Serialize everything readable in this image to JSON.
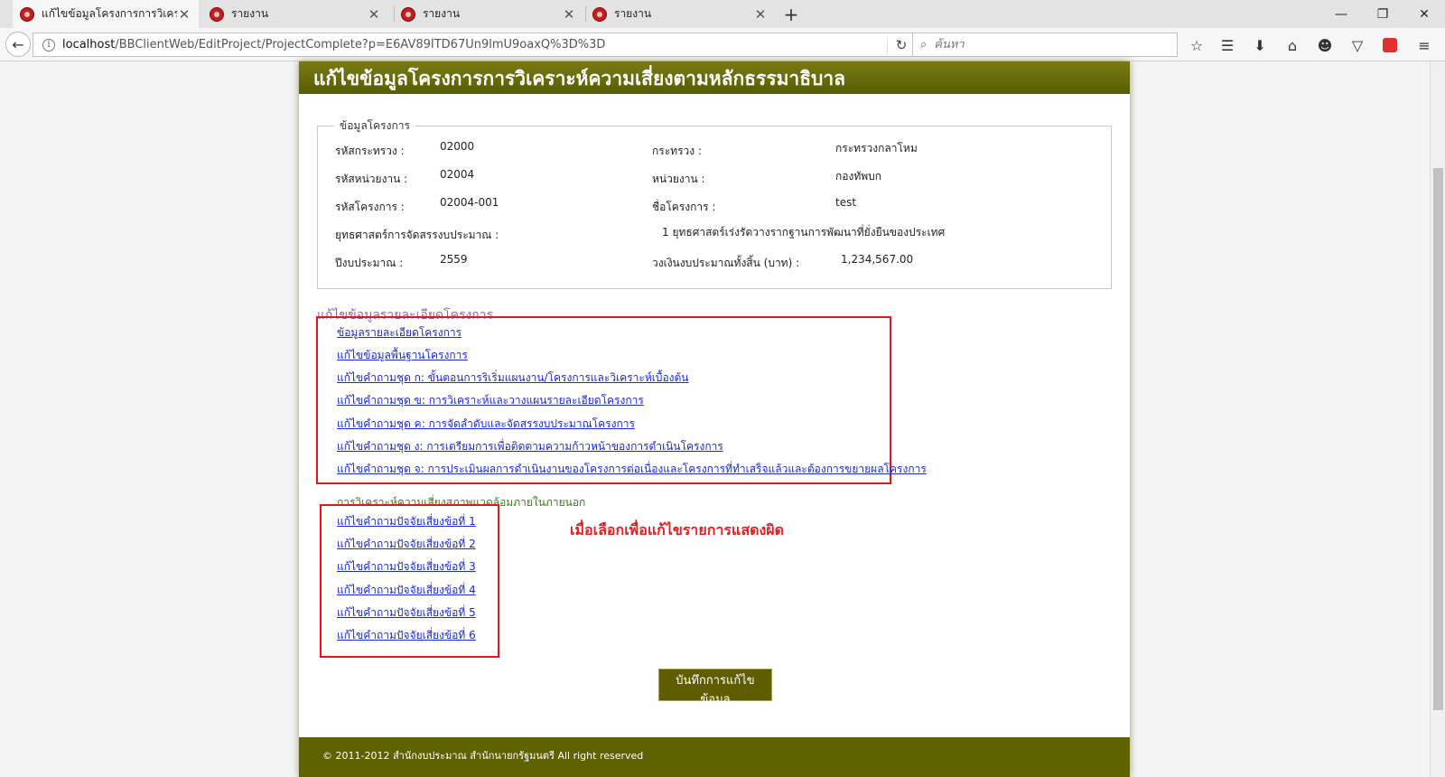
{
  "browser": {
    "tabs": [
      {
        "label": "แก้ไขข้อมูลโครงการการวิเคร...",
        "active": true,
        "close": "✕"
      },
      {
        "label": "รายงาน",
        "active": false,
        "close": "✕"
      },
      {
        "label": "รายงาน",
        "active": false,
        "close": "✕"
      },
      {
        "label": "รายงาน",
        "active": false,
        "close": "✕"
      }
    ],
    "new_tab": "+",
    "url_host": "localhost",
    "url_path": "/BBClientWeb/EditProject/ProjectComplete?p=E6AV89ITD67Un9lmU9oaxQ%3D%3D",
    "search_placeholder": "ค้นหา",
    "icons": [
      "star-icon",
      "reading-list-icon",
      "download-icon",
      "home-icon",
      "chat-icon",
      "pocket-icon",
      "extension-icon",
      "menu-icon"
    ]
  },
  "page": {
    "title": "แก้ไขข้อมูลโครงการการวิเคราะห์ความเสี่ยงตามหลักธรรมาธิบาล",
    "info_legend": "ข้อมูลโครงการ",
    "fields": {
      "ministry_code_label": "รหัสกระทรวง :",
      "ministry_code": "02000",
      "ministry_label": "กระทรวง :",
      "ministry": "กระทรวงกลาโหม",
      "dept_code_label": "รหัสหน่วยงาน :",
      "dept_code": "02004",
      "dept_label": "หน่วยงาน :",
      "dept": "กองทัพบก",
      "project_code_label": "รหัสโครงการ :",
      "project_code": "02004-001",
      "project_name_label": "ชื่อโครงการ :",
      "project_name": "test",
      "strategy_label": "ยุทธศาสตร์การจัดสรรงบประมาณ :",
      "strategy": "1 ยุทธศาสตร์เร่งรัดวางรากฐานการพัฒนาที่ยั่งยืนของประเทศ",
      "fiscal_year_label": "ปีงบประมาณ :",
      "fiscal_year": "2559",
      "budget_label": "วงเงินงบประมาณทั้งสิ้น (บาท) :",
      "budget": "1,234,567.00"
    },
    "detail_section_title": "แก้ไขข้อมูลรายละเอียดโครงการ",
    "detail_links": [
      "ข้อมูลรายละเอียดโครงการ",
      "แก้ไขข้อมูลพื้นฐานโครงการ",
      "แก้ไขคำถามชุด ก: ขั้นตอนการริเริ่มแผนงาน/โครงการและวิเคราะห์เบื้องต้น",
      "แก้ไขคำถามชุด ข: การวิเคราะห์และวางแผนรายละเอียดโครงการ",
      "แก้ไขคำถามชุด ค: การจัดลำดับและจัดสรรงบประมาณโครงการ",
      "แก้ไขคำถามชุด ง: การเตรียมการเพื่อติดตามความก้าวหน้าของการดำเนินโครงการ",
      "แก้ไขคำถามชุด จ: การประเมินผลการดำเนินงานของโครงการต่อเนื่องและโครงการที่ทำเสร็จแล้วและต้องการขยายผลโครงการ"
    ],
    "risk_heading": "การวิเคราะห์ความเสี่ยงสภาพแวดล้อมภายในภายนอก",
    "risk_links": [
      "แก้ไขคำถามปัจจัยเสี่ยงข้อที่ 1",
      "แก้ไขคำถามปัจจัยเสี่ยงข้อที่ 2",
      "แก้ไขคำถามปัจจัยเสี่ยงข้อที่ 3",
      "แก้ไขคำถามปัจจัยเสี่ยงข้อที่ 4",
      "แก้ไขคำถามปัจจัยเสี่ยงข้อที่ 5",
      "แก้ไขคำถามปัจจัยเสี่ยงข้อที่ 6"
    ],
    "annotation": "เมื่อเลือกเพื่อแก้ไขรายการแสดงผิด",
    "save_button": "บันทึกการแก้ไขข้อมูล",
    "footer": "© 2011-2012 สำนักงบประมาณ สำนักนายกรัฐมนตรี All right reserved"
  },
  "colors": {
    "header": "#5e6200",
    "link": "#1a2ad8",
    "annotation": "#e32020",
    "section": "#8c67a8"
  }
}
